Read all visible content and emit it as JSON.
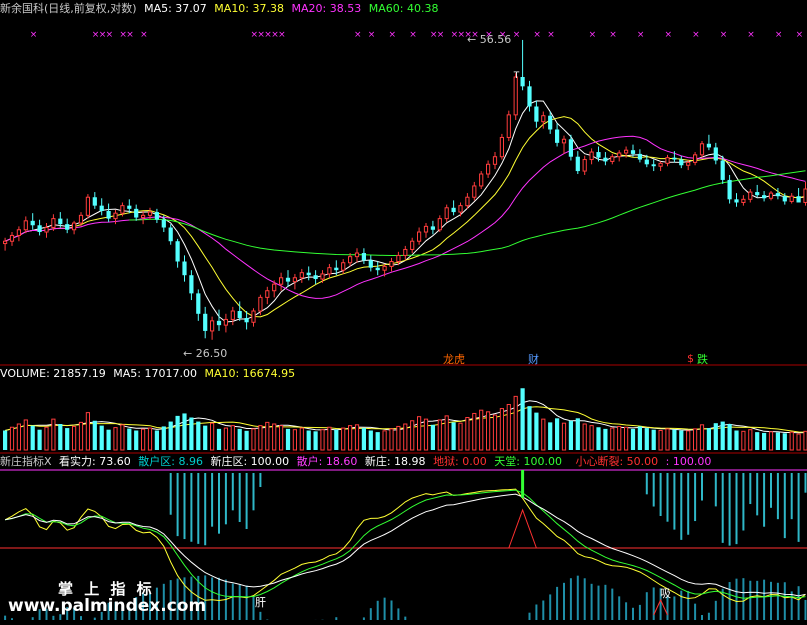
{
  "colors": {
    "up": "#ff3d3d",
    "down": "#54ffff",
    "ma5": "#ffffff",
    "ma10": "#ffff33",
    "ma20": "#ff33ff",
    "ma60": "#33ff33",
    "text_title": "#c8c8c8",
    "divider": "#aa0000"
  },
  "price_panel": {
    "title": "新余国科(日线,前复权,对数)",
    "ma5": "MA5: 37.07",
    "ma10": "MA10: 37.38",
    "ma20": "MA20: 38.53",
    "ma60": "MA60: 40.38",
    "high_label": "56.56",
    "low_label": "26.50",
    "markers": [
      "龙虎",
      "财",
      "$",
      "跌"
    ]
  },
  "volume_panel": {
    "label": "VOLUME: 21857.19",
    "ma5": "MA5: 17017.00",
    "ma10": "MA10: 16674.95"
  },
  "indicator_panel": {
    "name": "新庄指标X",
    "items": [
      {
        "text": "看实力: 73.60",
        "color": "#ffffff"
      },
      {
        "text": "散户区: 8.96",
        "color": "#00cccc"
      },
      {
        "text": "新庄区: 100.00",
        "color": "#ffffff"
      },
      {
        "text": "散户: 18.60",
        "color": "#ff3dff"
      },
      {
        "text": "新庄: 18.98",
        "color": "#ffffff"
      },
      {
        "text": "地狱: 0.00",
        "color": "#ff3030"
      },
      {
        "text": "天堂: 100.00",
        "color": "#33ff33"
      },
      {
        "text": "小心断裂: 50.00",
        "color": "#ff3030"
      },
      {
        "text": ": 100.00",
        "color": "#ff33ff"
      }
    ],
    "bottom_markers": [
      "肝",
      "吸"
    ]
  },
  "watermark": {
    "line1": "掌 上 指 标",
    "line2": "www.palmindex.com"
  },
  "chart_data": {
    "type": "candlestick",
    "scale": "log",
    "price_ylim": [
      25.5,
      58
    ],
    "high_marked": 56.56,
    "low_marked": 26.5,
    "ohlc": [
      [
        33.8,
        34.3,
        33.2,
        34
      ],
      [
        34,
        34.8,
        33.6,
        34.5
      ],
      [
        34.5,
        35.3,
        34,
        35
      ],
      [
        35,
        36.2,
        34.7,
        35.8
      ],
      [
        35.8,
        36.5,
        35,
        35.4
      ],
      [
        35.4,
        35.9,
        34.5,
        34.8
      ],
      [
        34.8,
        35.6,
        34.3,
        35.2
      ],
      [
        35.2,
        36.4,
        34.9,
        36
      ],
      [
        36,
        36.6,
        35.2,
        35.5
      ],
      [
        35.5,
        36,
        34.7,
        35
      ],
      [
        35,
        35.8,
        34.6,
        35.6
      ],
      [
        35.6,
        36.6,
        35.3,
        36.3
      ],
      [
        36.3,
        38.3,
        36,
        38
      ],
      [
        38,
        38.5,
        36.9,
        37.2
      ],
      [
        37.2,
        37.9,
        36.3,
        36.7
      ],
      [
        36.7,
        37.4,
        35.7,
        36
      ],
      [
        36,
        36.8,
        35.5,
        36.5
      ],
      [
        36.5,
        37.5,
        36.2,
        37.2
      ],
      [
        37.2,
        37.8,
        36.5,
        36.9
      ],
      [
        36.9,
        37.3,
        35.8,
        36.1
      ],
      [
        36.1,
        36.7,
        35.5,
        36.3
      ],
      [
        36.3,
        37,
        35.9,
        36.6
      ],
      [
        36.6,
        36.9,
        35.6,
        35.9
      ],
      [
        35.9,
        36.3,
        34.8,
        35.2
      ],
      [
        35.2,
        35.5,
        33.7,
        34
      ],
      [
        34,
        34.2,
        31.8,
        32.3
      ],
      [
        32.3,
        32.8,
        30.7,
        31.2
      ],
      [
        31.2,
        31.6,
        29.3,
        29.8
      ],
      [
        29.8,
        30.1,
        27.8,
        28.3
      ],
      [
        28.3,
        28.8,
        26.6,
        27.1
      ],
      [
        27.1,
        28.1,
        26.5,
        27.8
      ],
      [
        27.8,
        28.6,
        27.1,
        27.5
      ],
      [
        27.5,
        28.3,
        27,
        27.9
      ],
      [
        27.9,
        28.8,
        27.5,
        28.5
      ],
      [
        28.5,
        29.2,
        27.8,
        28
      ],
      [
        28,
        28.5,
        27.2,
        27.7
      ],
      [
        27.7,
        28.7,
        27.4,
        28.5
      ],
      [
        28.5,
        29.7,
        28.2,
        29.5
      ],
      [
        29.5,
        30.3,
        29,
        30
      ],
      [
        30,
        30.8,
        29.5,
        30.5
      ],
      [
        30.5,
        31.4,
        30,
        31
      ],
      [
        31,
        31.6,
        30.3,
        30.7
      ],
      [
        30.7,
        31.3,
        30.1,
        31
      ],
      [
        31,
        31.7,
        30.6,
        31.4
      ],
      [
        31.4,
        31.9,
        30.8,
        31.2
      ],
      [
        31.2,
        31.6,
        30.5,
        30.9
      ],
      [
        30.9,
        31.6,
        30.6,
        31.3
      ],
      [
        31.3,
        32.1,
        31,
        31.8
      ],
      [
        31.8,
        32.4,
        31.2,
        31.6
      ],
      [
        31.6,
        32.5,
        31.3,
        32.2
      ],
      [
        32.2,
        33,
        31.9,
        32.7
      ],
      [
        32.7,
        33.4,
        32.2,
        33
      ],
      [
        33,
        33.4,
        32.1,
        32.4
      ],
      [
        32.4,
        32.8,
        31.5,
        31.8
      ],
      [
        31.8,
        32.3,
        31.2,
        31.6
      ],
      [
        31.6,
        32.1,
        31.1,
        31.9
      ],
      [
        31.9,
        32.6,
        31.5,
        32.3
      ],
      [
        32.3,
        33.1,
        32,
        32.8
      ],
      [
        32.8,
        33.6,
        32.4,
        33.3
      ],
      [
        33.3,
        34.3,
        33,
        34
      ],
      [
        34,
        35.2,
        33.7,
        34.8
      ],
      [
        34.8,
        35.6,
        34.3,
        35.3
      ],
      [
        35.3,
        35.8,
        34.6,
        35
      ],
      [
        35,
        36.3,
        34.8,
        36
      ],
      [
        36,
        37.3,
        35.7,
        37
      ],
      [
        37,
        37.7,
        36.3,
        36.6
      ],
      [
        36.6,
        37.5,
        36.2,
        37.2
      ],
      [
        37.2,
        38.4,
        36.9,
        38
      ],
      [
        38,
        39.5,
        37.7,
        39.1
      ],
      [
        39.1,
        40.6,
        38.8,
        40.3
      ],
      [
        40.3,
        41.7,
        39.9,
        41.3
      ],
      [
        41.3,
        42.6,
        40.8,
        42.1
      ],
      [
        42.1,
        44.6,
        41.8,
        44.2
      ],
      [
        44.2,
        47.3,
        43.8,
        46.8
      ],
      [
        46.8,
        52,
        46.2,
        51.5
      ],
      [
        51.5,
        56.56,
        49.8,
        50.3
      ],
      [
        50.3,
        51,
        47.2,
        47.8
      ],
      [
        47.8,
        48.5,
        45.3,
        46
      ],
      [
        46,
        47.2,
        45.2,
        46.7
      ],
      [
        46.7,
        47.2,
        44.6,
        45.1
      ],
      [
        45.1,
        45.8,
        43.2,
        43.6
      ],
      [
        43.6,
        44.4,
        42.4,
        44
      ],
      [
        44,
        44.5,
        41.7,
        42.1
      ],
      [
        42.1,
        42.7,
        40.3,
        40.6
      ],
      [
        40.6,
        42.2,
        40.2,
        41.8
      ],
      [
        41.8,
        43,
        41.3,
        42.6
      ],
      [
        42.6,
        43.2,
        41.6,
        42
      ],
      [
        42,
        42.6,
        41.2,
        41.6
      ],
      [
        41.6,
        42.4,
        41.3,
        42.1
      ],
      [
        42.1,
        42.8,
        41.6,
        42.5
      ],
      [
        42.5,
        43.2,
        42,
        42.8
      ],
      [
        42.8,
        43.4,
        42.1,
        42.4
      ],
      [
        42.4,
        42.9,
        41.5,
        41.8
      ],
      [
        41.8,
        42.3,
        41,
        41.3
      ],
      [
        41.3,
        41.8,
        40.6,
        41.1
      ],
      [
        41.1,
        41.6,
        40.6,
        41.4
      ],
      [
        41.4,
        42.3,
        41.1,
        42
      ],
      [
        42,
        42.7,
        41.5,
        41.8
      ],
      [
        41.8,
        42.2,
        40.9,
        41.2
      ],
      [
        41.2,
        41.8,
        40.7,
        41.5
      ],
      [
        41.5,
        42.6,
        41.2,
        42.3
      ],
      [
        42.3,
        43.8,
        42,
        43.5
      ],
      [
        43.5,
        44.5,
        42.8,
        43.1
      ],
      [
        43.1,
        43.6,
        41.3,
        41.7
      ],
      [
        41.7,
        42.2,
        39.3,
        39.7
      ],
      [
        39.7,
        40.2,
        37.4,
        37.8
      ],
      [
        37.8,
        38.4,
        37.1,
        37.5
      ],
      [
        37.5,
        38.2,
        37.2,
        37.8
      ],
      [
        37.8,
        38.8,
        37.5,
        38.5
      ],
      [
        38.5,
        39.2,
        38,
        38.2
      ],
      [
        38.2,
        38.6,
        37.6,
        37.9
      ],
      [
        37.9,
        38.6,
        37.7,
        38.4
      ],
      [
        38.4,
        38.9,
        37.8,
        38.1
      ],
      [
        38.1,
        38.4,
        37.3,
        37.6
      ],
      [
        37.6,
        38.4,
        37.4,
        38.1
      ],
      [
        38.1,
        38.9,
        37.8,
        37.5
      ],
      [
        37.5,
        39.5,
        37.2,
        38.8
      ]
    ],
    "volume": [
      [
        12000,
        0
      ],
      [
        14000,
        1
      ],
      [
        16000,
        1
      ],
      [
        18500,
        1
      ],
      [
        15000,
        0
      ],
      [
        12500,
        0
      ],
      [
        14000,
        1
      ],
      [
        19000,
        1
      ],
      [
        16000,
        0
      ],
      [
        13500,
        0
      ],
      [
        14500,
        1
      ],
      [
        17000,
        1
      ],
      [
        23000,
        1
      ],
      [
        18000,
        0
      ],
      [
        15000,
        0
      ],
      [
        12500,
        0
      ],
      [
        13800,
        1
      ],
      [
        15500,
        1
      ],
      [
        13200,
        0
      ],
      [
        12000,
        0
      ],
      [
        12800,
        1
      ],
      [
        13500,
        1
      ],
      [
        12000,
        0
      ],
      [
        14500,
        0
      ],
      [
        17500,
        0
      ],
      [
        21000,
        0
      ],
      [
        22500,
        0
      ],
      [
        20000,
        0
      ],
      [
        17500,
        0
      ],
      [
        15000,
        0
      ],
      [
        16500,
        1
      ],
      [
        13000,
        0
      ],
      [
        13500,
        1
      ],
      [
        15000,
        1
      ],
      [
        13000,
        0
      ],
      [
        11800,
        0
      ],
      [
        13000,
        1
      ],
      [
        15000,
        1
      ],
      [
        17000,
        1
      ],
      [
        16000,
        1
      ],
      [
        15000,
        1
      ],
      [
        13000,
        0
      ],
      [
        12500,
        1
      ],
      [
        13500,
        1
      ],
      [
        12000,
        0
      ],
      [
        11500,
        0
      ],
      [
        12500,
        1
      ],
      [
        14000,
        1
      ],
      [
        12500,
        0
      ],
      [
        13500,
        1
      ],
      [
        15000,
        1
      ],
      [
        15500,
        1
      ],
      [
        13500,
        0
      ],
      [
        12000,
        0
      ],
      [
        11000,
        0
      ],
      [
        11800,
        1
      ],
      [
        13000,
        1
      ],
      [
        14500,
        1
      ],
      [
        16000,
        1
      ],
      [
        18000,
        1
      ],
      [
        20500,
        1
      ],
      [
        19000,
        1
      ],
      [
        15500,
        0
      ],
      [
        18500,
        1
      ],
      [
        21000,
        1
      ],
      [
        17000,
        0
      ],
      [
        16500,
        1
      ],
      [
        20000,
        1
      ],
      [
        22500,
        1
      ],
      [
        24500,
        1
      ],
      [
        23500,
        1
      ],
      [
        21500,
        1
      ],
      [
        25500,
        1
      ],
      [
        28000,
        1
      ],
      [
        33000,
        1
      ],
      [
        38000,
        0
      ],
      [
        27000,
        0
      ],
      [
        23000,
        0
      ],
      [
        19000,
        1
      ],
      [
        17000,
        0
      ],
      [
        19500,
        0
      ],
      [
        16500,
        1
      ],
      [
        18000,
        0
      ],
      [
        19500,
        0
      ],
      [
        16000,
        1
      ],
      [
        15000,
        1
      ],
      [
        14000,
        0
      ],
      [
        13000,
        0
      ],
      [
        13500,
        1
      ],
      [
        14500,
        1
      ],
      [
        14000,
        1
      ],
      [
        13000,
        0
      ],
      [
        14500,
        0
      ],
      [
        13500,
        0
      ],
      [
        12500,
        0
      ],
      [
        12000,
        1
      ],
      [
        13000,
        1
      ],
      [
        12500,
        0
      ],
      [
        12000,
        0
      ],
      [
        11800,
        1
      ],
      [
        13000,
        1
      ],
      [
        15500,
        1
      ],
      [
        13500,
        0
      ],
      [
        16500,
        0
      ],
      [
        17500,
        0
      ],
      [
        16000,
        0
      ],
      [
        12000,
        0
      ],
      [
        11500,
        1
      ],
      [
        12500,
        1
      ],
      [
        11000,
        0
      ],
      [
        10500,
        0
      ],
      [
        11200,
        1
      ],
      [
        10800,
        0
      ],
      [
        10300,
        0
      ],
      [
        11000,
        1
      ],
      [
        9800,
        1
      ],
      [
        11500,
        1
      ]
    ]
  }
}
